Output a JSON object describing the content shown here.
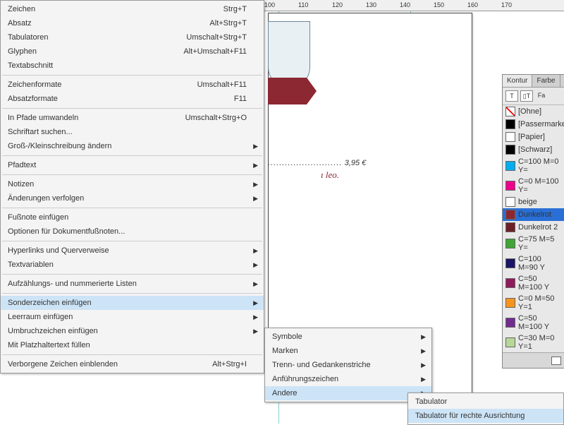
{
  "ruler": {
    "ticks": [
      "100",
      "110",
      "120",
      "130",
      "140",
      "150",
      "160",
      "170"
    ]
  },
  "document": {
    "price": "3,95 €",
    "dots": "..........................",
    "leo": "ı leo."
  },
  "menu1": [
    {
      "l": "Zeichen",
      "s": "Strg+T"
    },
    {
      "l": "Absatz",
      "s": "Alt+Strg+T"
    },
    {
      "l": "Tabulatoren",
      "s": "Umschalt+Strg+T"
    },
    {
      "l": "Glyphen",
      "s": "Alt+Umschalt+F11"
    },
    {
      "l": "Textabschnitt",
      "s": ""
    },
    {
      "sep": true
    },
    {
      "l": "Zeichenformate",
      "s": "Umschalt+F11"
    },
    {
      "l": "Absatzformate",
      "s": "F11"
    },
    {
      "sep": true
    },
    {
      "l": "In Pfade umwandeln",
      "s": "Umschalt+Strg+O",
      "dis": true
    },
    {
      "l": "Schriftart suchen...",
      "s": ""
    },
    {
      "l": "Groß-/Kleinschreibung ändern",
      "s": "",
      "sub": true
    },
    {
      "sep": true
    },
    {
      "l": "Pfadtext",
      "s": "",
      "sub": true
    },
    {
      "sep": true
    },
    {
      "l": "Notizen",
      "s": "",
      "sub": true
    },
    {
      "l": "Änderungen verfolgen",
      "s": "",
      "sub": true
    },
    {
      "sep": true
    },
    {
      "l": "Fußnote einfügen",
      "s": ""
    },
    {
      "l": "Optionen für Dokumentfußnoten...",
      "s": ""
    },
    {
      "sep": true
    },
    {
      "l": "Hyperlinks und Querverweise",
      "s": "",
      "sub": true
    },
    {
      "l": "Textvariablen",
      "s": "",
      "sub": true
    },
    {
      "sep": true
    },
    {
      "l": "Aufzählungs- und nummerierte Listen",
      "s": "",
      "sub": true
    },
    {
      "sep": true
    },
    {
      "l": "Sonderzeichen einfügen",
      "s": "",
      "sub": true,
      "sel": true
    },
    {
      "l": "Leerraum einfügen",
      "s": "",
      "sub": true
    },
    {
      "l": "Umbruchzeichen einfügen",
      "s": "",
      "sub": true
    },
    {
      "l": "Mit Platzhaltertext füllen",
      "s": ""
    },
    {
      "sep": true
    },
    {
      "l": "Verborgene Zeichen einblenden",
      "s": "Alt+Strg+I"
    }
  ],
  "menu2": [
    {
      "l": "Symbole",
      "sub": true
    },
    {
      "l": "Marken",
      "sub": true
    },
    {
      "l": "Trenn- und Gedankenstriche",
      "sub": true
    },
    {
      "l": "Anführungszeichen",
      "sub": true
    },
    {
      "l": "Andere",
      "sub": true,
      "sel": true
    }
  ],
  "menu3": [
    {
      "l": "Tabulator"
    },
    {
      "l": "Tabulator für rechte Ausrichtung",
      "sel": true
    }
  ],
  "panel": {
    "tabs": [
      "Kontur",
      "Farbe"
    ],
    "iconrow": {
      "label": "Fa"
    },
    "swatches": [
      {
        "n": "[Ohne]",
        "c": "none"
      },
      {
        "n": "[Passermarken]",
        "c": "#000"
      },
      {
        "n": "[Papier]",
        "c": "#fff"
      },
      {
        "n": "[Schwarz]",
        "c": "#000"
      },
      {
        "n": "C=100 M=0 Y=",
        "c": "#00aeef"
      },
      {
        "n": "C=0 M=100 Y=",
        "c": "#ec008c"
      },
      {
        "n": "beige",
        "c": "#fff"
      },
      {
        "n": "Dunkelrot",
        "c": "#8b2831",
        "sel": true
      },
      {
        "n": "Dunkelrot 2",
        "c": "#6d1f27"
      },
      {
        "n": "C=75 M=5 Y=",
        "c": "#3fa535"
      },
      {
        "n": "C=100 M=90 Y",
        "c": "#1b1464"
      },
      {
        "n": "C=50 M=100 Y",
        "c": "#8e1b5c"
      },
      {
        "n": "C=0 M=50 Y=1",
        "c": "#f7941d"
      },
      {
        "n": "C=50 M=100 Y",
        "c": "#722c8f"
      },
      {
        "n": "C=30 M=0 Y=1",
        "c": "#b7d698"
      }
    ]
  }
}
